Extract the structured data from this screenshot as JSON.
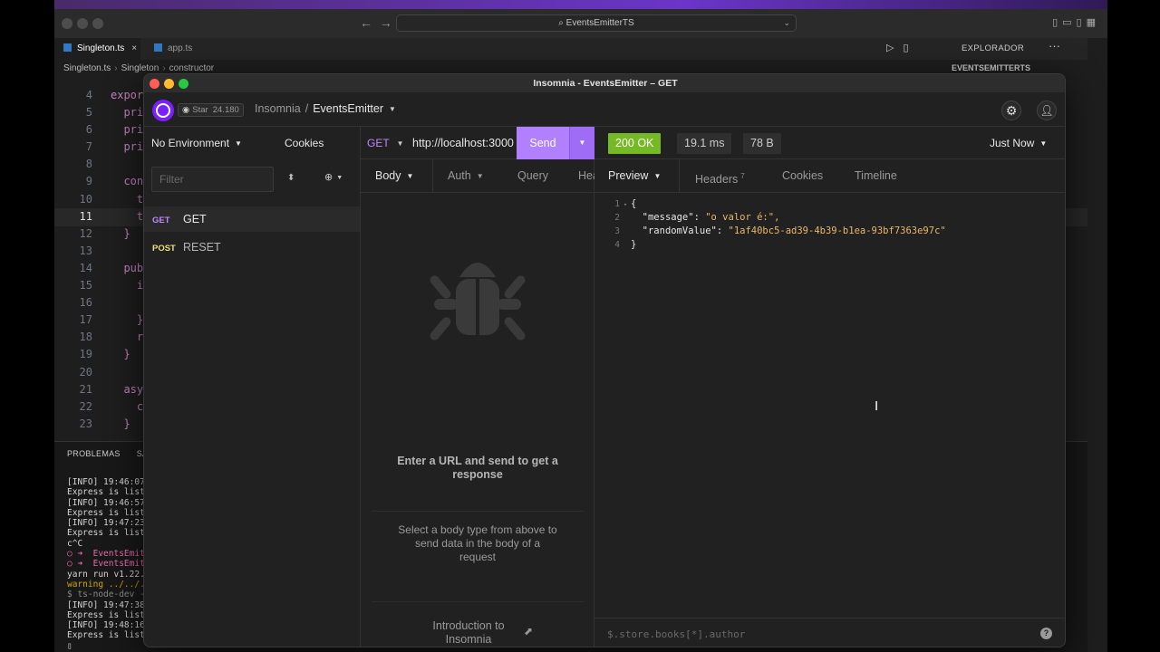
{
  "vscode": {
    "search": "EventsEmitterTS",
    "tabs": [
      {
        "label": "Singleton.ts",
        "close": "×"
      },
      {
        "label": "app.ts"
      }
    ],
    "explorer": {
      "title": "EXPLORADOR",
      "sub": "EVENTSEMITTERTS",
      "dots": "···"
    },
    "breadcrumb": [
      "Singleton.ts",
      "Singleton",
      "constructor"
    ],
    "line_numbers": [
      "4",
      "5",
      "6",
      "7",
      "8",
      "9",
      "10",
      "11",
      "12",
      "13",
      "14",
      "15",
      "16",
      "17",
      "18",
      "19",
      "20",
      "21",
      "22",
      "23"
    ],
    "code_lines": [
      "expor",
      "  pri",
      "  pri",
      "  pri",
      "",
      "  con",
      "    t",
      "    t",
      "  }",
      "",
      "  pub",
      "    i",
      "",
      "    }",
      "    r",
      "  }",
      "",
      "  asy",
      "    c",
      "  }"
    ],
    "panel_tabs": [
      "PROBLEMAS",
      "SA"
    ],
    "terminal": [
      "[INFO] 19:46:07",
      "Express is list",
      "[INFO] 19:46:57",
      "Express is list",
      "[INFO] 19:47:23",
      "Express is list",
      "c^C",
      "○ ➜  EventsEmitte",
      "○ ➜  EventsEmitte",
      "yarn run v1.22.",
      "warning ../../.",
      "$ ts-node-dev -",
      "[INFO] 19:47:38",
      "Express is list",
      "[INFO] 19:48:16",
      "Express is list",
      "▯"
    ]
  },
  "insomnia": {
    "window_title": "Insomnia - EventsEmitter – GET",
    "star": {
      "label": "Star",
      "count": "24.180"
    },
    "breadcrumb": {
      "root": "Insomnia",
      "separator": "/",
      "current": "EventsEmitter"
    },
    "sidebar": {
      "environment": "No Environment",
      "cookies": "Cookies",
      "filter_placeholder": "Filter",
      "requests": [
        {
          "method": "GET",
          "name": "GET"
        },
        {
          "method": "POST",
          "name": "RESET"
        }
      ]
    },
    "request": {
      "method": "GET",
      "url": "http://localhost:3000",
      "send_label": "Send",
      "tabs": [
        "Body",
        "Auth",
        "Query",
        "Headers"
      ],
      "empty_title": "Enter a URL and send to get a response",
      "empty_body": "Select a body type from above to send data in the body of a request",
      "intro_link": "Introduction to Insomnia"
    },
    "response": {
      "status": "200 OK",
      "time": "19.1 ms",
      "size": "78 B",
      "when": "Just Now",
      "tabs": [
        "Preview",
        "Headers",
        "Cookies",
        "Timeline"
      ],
      "headers_count": "7",
      "json_lines": [
        {
          "num": "1",
          "fold": "▾",
          "text": "{"
        },
        {
          "num": "2",
          "key": "\"message\"",
          "value": "\"o valor é:\","
        },
        {
          "num": "3",
          "key": "\"randomValue\"",
          "value": "\"1af40bc5-ad39-4b39-b1ea-93bf7363e97c\""
        },
        {
          "num": "4",
          "text": "}"
        }
      ],
      "filter_placeholder": "$.store.books[*].author"
    }
  }
}
